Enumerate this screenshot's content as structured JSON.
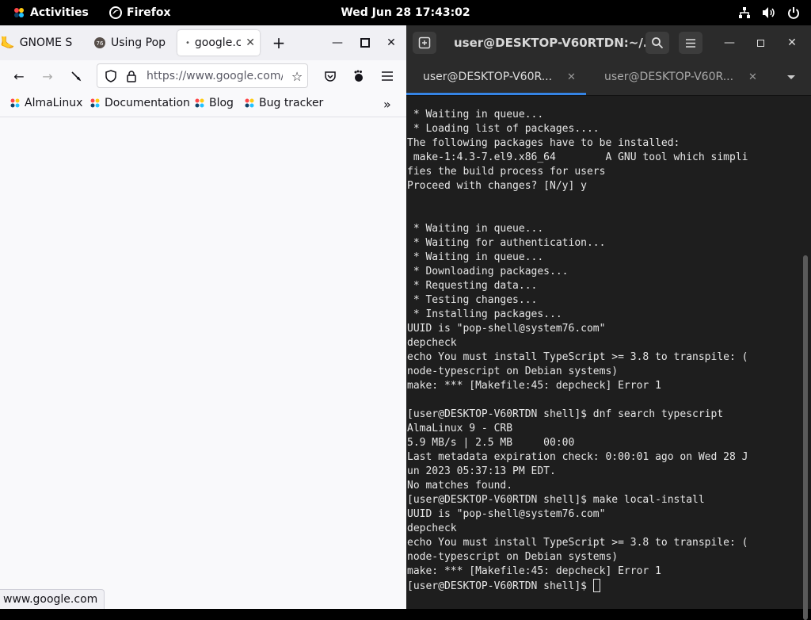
{
  "topbar": {
    "activities": "Activities",
    "app_name": "Firefox",
    "clock": "Wed Jun 28  17:43:02"
  },
  "firefox": {
    "tabs": [
      {
        "label": "GNOME S"
      },
      {
        "label": "Using Pop"
      },
      {
        "label": "google.c"
      }
    ],
    "url": "https://www.google.com/",
    "bookmarks": [
      {
        "label": "AlmaLinux"
      },
      {
        "label": "Documentation"
      },
      {
        "label": "Blog"
      },
      {
        "label": "Bug tracker"
      }
    ],
    "status_url": "www.google.com"
  },
  "terminal": {
    "title": "user@DESKTOP-V60RTDN:~/...",
    "tabs": [
      {
        "label": "user@DESKTOP-V60R..."
      },
      {
        "label": "user@DESKTOP-V60R..."
      }
    ],
    "lines": [
      " * Waiting in queue...",
      " * Loading list of packages....",
      "The following packages have to be installed:",
      " make-1:4.3-7.el9.x86_64        A GNU tool which simpli",
      "fies the build process for users",
      "Proceed with changes? [N/y] y",
      "",
      "",
      " * Waiting in queue...",
      " * Waiting for authentication...",
      " * Waiting in queue...",
      " * Downloading packages...",
      " * Requesting data...",
      " * Testing changes...",
      " * Installing packages...",
      "UUID is \"pop-shell@system76.com\"",
      "depcheck",
      "echo You must install TypeScript >= 3.8 to transpile: (",
      "node-typescript on Debian systems)",
      "make: *** [Makefile:45: depcheck] Error 1",
      "",
      "[user@DESKTOP-V60RTDN shell]$ dnf search typescript",
      "AlmaLinux 9 - CRB",
      "5.9 MB/s | 2.5 MB     00:00",
      "Last metadata expiration check: 0:00:01 ago on Wed 28 J",
      "un 2023 05:37:13 PM EDT.",
      "No matches found.",
      "[user@DESKTOP-V60RTDN shell]$ make local-install",
      "UUID is \"pop-shell@system76.com\"",
      "depcheck",
      "echo You must install TypeScript >= 3.8 to transpile: (",
      "node-typescript on Debian systems)",
      "make: *** [Makefile:45: depcheck] Error 1"
    ],
    "prompt": "[user@DESKTOP-V60RTDN shell]$ "
  }
}
